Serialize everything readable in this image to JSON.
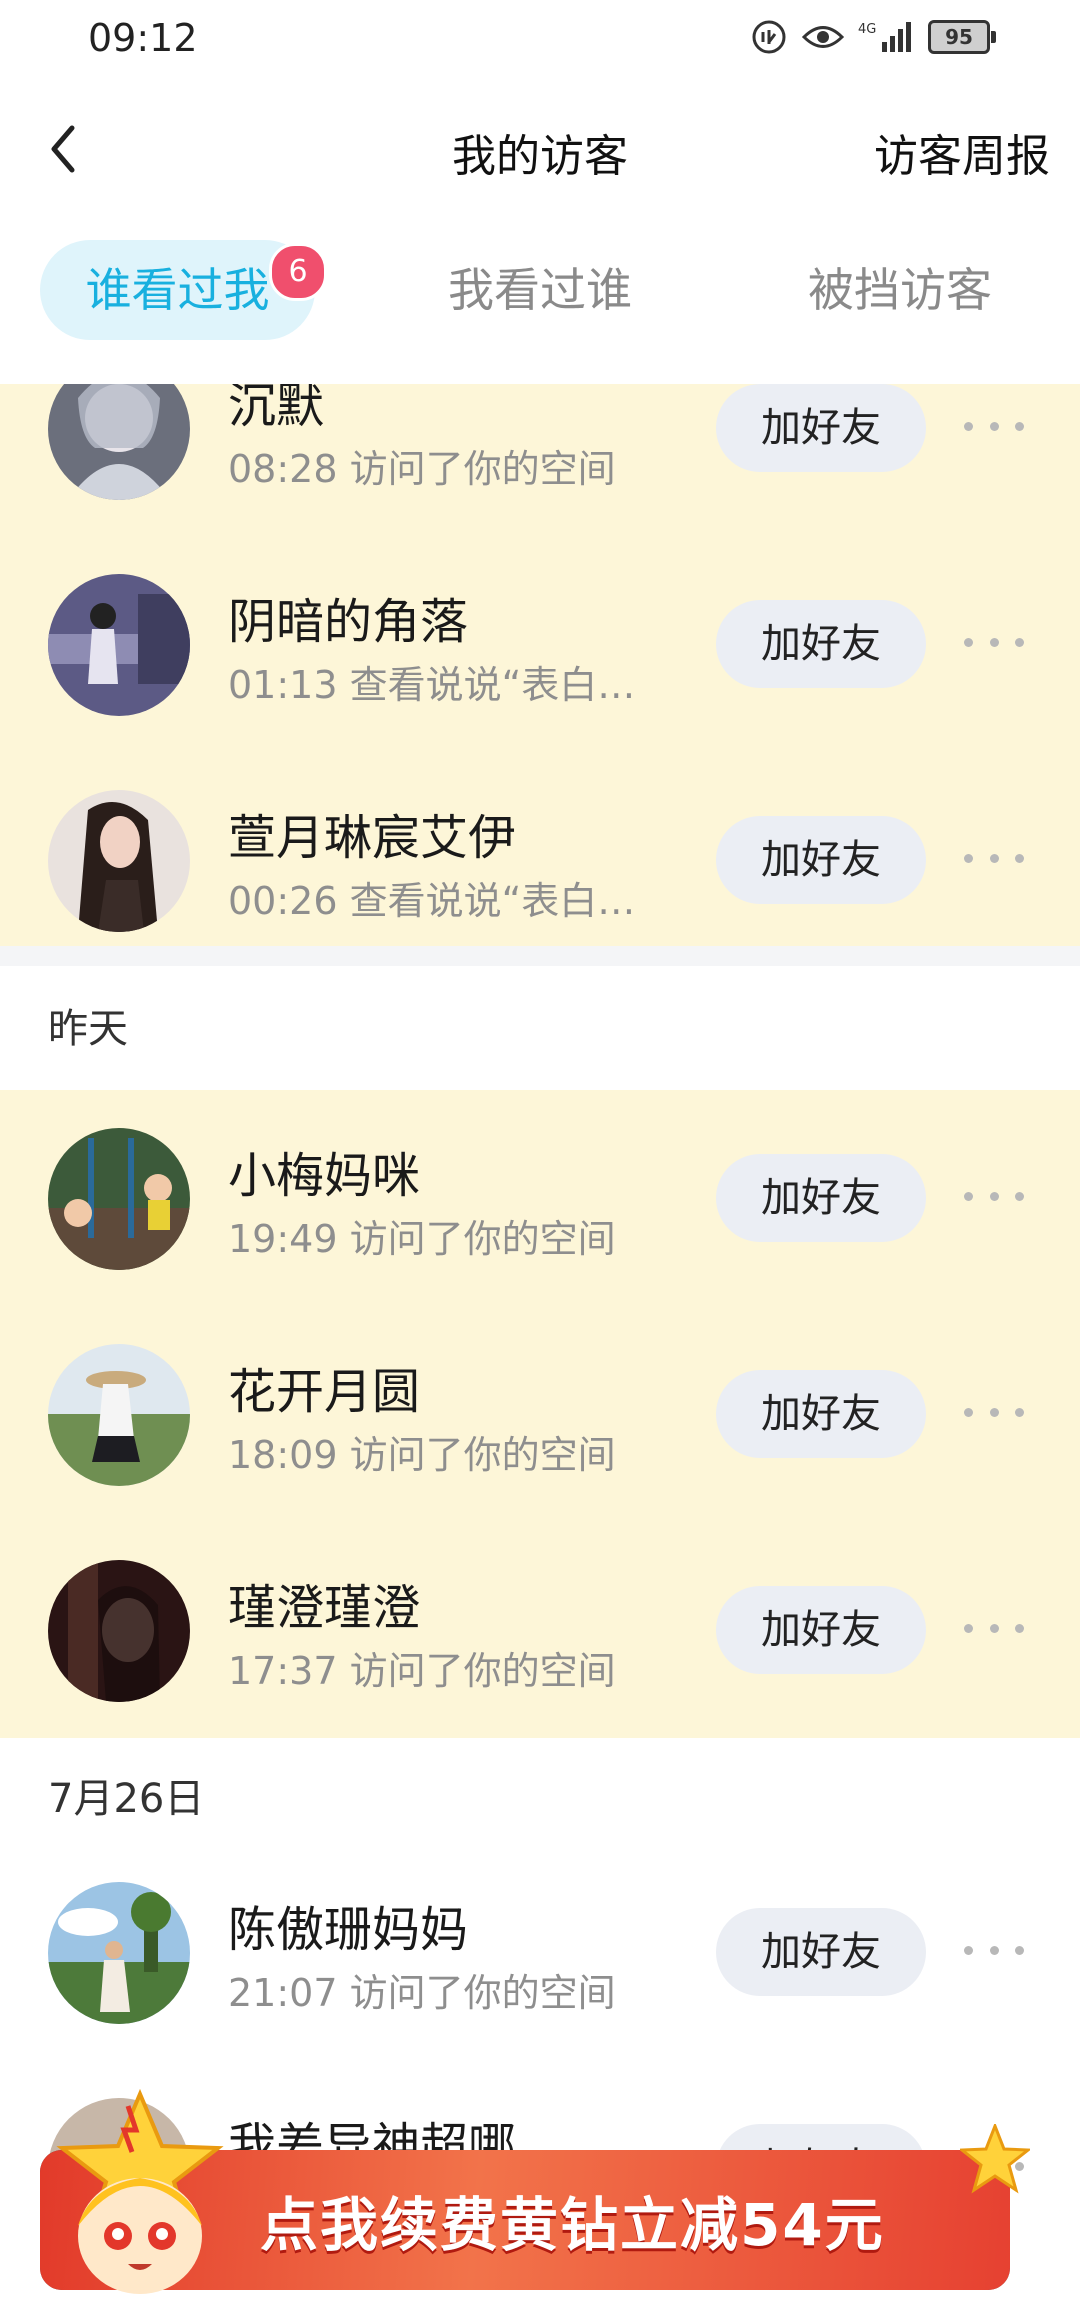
{
  "status": {
    "time": "09:12",
    "battery": "95",
    "network": "4G"
  },
  "header": {
    "title": "我的访客",
    "right_link": "访客周报"
  },
  "tabs": [
    {
      "label": "谁看过我",
      "badge": "6"
    },
    {
      "label": "我看过谁"
    },
    {
      "label": "被挡访客"
    }
  ],
  "sections": {
    "today_items": [
      {
        "name": "沉默",
        "desc": "08:28 访问了你的空间",
        "button": "加好友"
      },
      {
        "name": "阴暗的角落",
        "desc": "01:13 查看说说“表白…",
        "button": "加好友"
      },
      {
        "name": "萱月琳宸艾伊",
        "desc": "00:26 查看说说“表白…",
        "button": "加好友"
      }
    ],
    "yesterday_label": "昨天",
    "yesterday_items": [
      {
        "name": "小梅妈咪",
        "desc": "19:49 访问了你的空间",
        "button": "加好友"
      },
      {
        "name": "花开月圆",
        "desc": "18:09 访问了你的空间",
        "button": "加好友"
      },
      {
        "name": "瑾澄瑾澄",
        "desc": "17:37 访问了你的空间",
        "button": "加好友"
      }
    ],
    "date_label": "7月26日",
    "date_items": [
      {
        "name": "陈傲珊妈妈",
        "desc": "21:07 访问了你的空间",
        "button": "加好友"
      },
      {
        "name": "我差异神超哪",
        "desc": "",
        "button": "加好友"
      }
    ]
  },
  "banner": {
    "text": "点我续费黄钻立减54元"
  },
  "colors": {
    "accent": "#18b0df",
    "highlight_bg": "#fdf6d8",
    "badge": "#f04f6d"
  }
}
